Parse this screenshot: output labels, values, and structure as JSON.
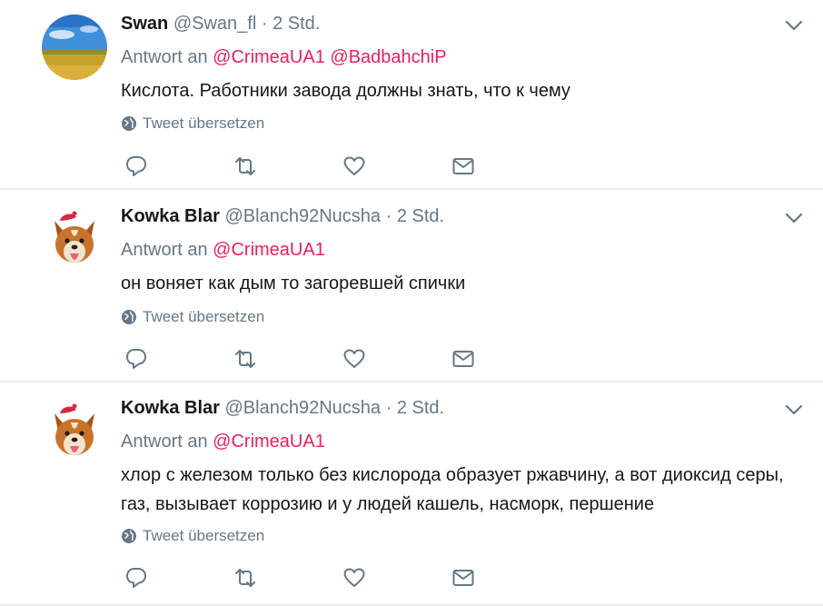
{
  "tweets": [
    {
      "name": "Swan",
      "handle": "@Swan_fl",
      "dot": "·",
      "time": "2 Std.",
      "reply_prefix": "Antwort an",
      "mentions": [
        "@CrimeaUA1",
        "@BadbahchiP"
      ],
      "text": "Кислота. Работники завода должны знать, что к чему",
      "translate": "Tweet übersetzen",
      "avatar": "landscape-avatar"
    },
    {
      "name": "Kowka Blar",
      "handle": "@Blanch92Nucsha",
      "dot": "·",
      "time": "2 Std.",
      "reply_prefix": "Antwort an",
      "mentions": [
        "@CrimeaUA1"
      ],
      "text": "он воняет как дым то загоревшей спички",
      "translate": "Tweet übersetzen",
      "avatar": "dog-avatar"
    },
    {
      "name": "Kowka Blar",
      "handle": "@Blanch92Nucsha",
      "dot": "·",
      "time": "2 Std.",
      "reply_prefix": "Antwort an",
      "mentions": [
        "@CrimeaUA1"
      ],
      "text": "хлор с железом только без кислорода образует ржавчину, а вот диоксид серы, газ, вызывает коррозию и у людей кашель, насморк, першение",
      "translate": "Tweet übersetzen",
      "avatar": "dog-avatar"
    }
  ],
  "icons": {
    "reply": "reply-icon",
    "retweet": "retweet-icon",
    "like": "like-icon",
    "dm": "message-icon",
    "chevron": "chevron-down-icon",
    "globe": "globe-icon"
  },
  "colors": {
    "mention": "#e0245e",
    "secondary_text": "#657786",
    "divider": "#e6ecf0"
  }
}
